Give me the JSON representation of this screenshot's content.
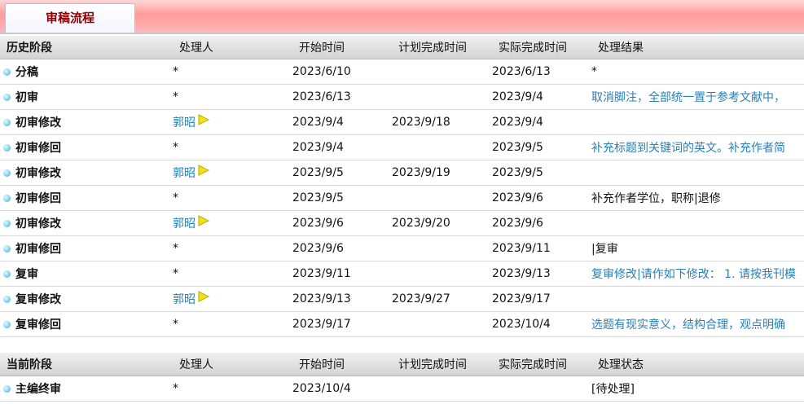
{
  "tab": {
    "label": "审稿流程"
  },
  "history": {
    "headers": [
      "历史阶段",
      "处理人",
      "开始时间",
      "计划完成时间",
      "实际完成时间",
      "处理结果"
    ],
    "rows": [
      {
        "stage": "分稿",
        "person": "*",
        "start": "2023/6/10",
        "plan": "",
        "actual": "2023/6/13",
        "result": "*",
        "person_link": false,
        "result_link": false
      },
      {
        "stage": "初审",
        "person": "*",
        "start": "2023/6/13",
        "plan": "",
        "actual": "2023/9/4",
        "result": "取消脚注，全部统一置于参考文献中，",
        "person_link": false,
        "result_link": true
      },
      {
        "stage": "初审修改",
        "person": "郭昭",
        "start": "2023/9/4",
        "plan": "2023/9/18",
        "actual": "2023/9/4",
        "result": "",
        "person_link": true,
        "result_link": false
      },
      {
        "stage": "初审修回",
        "person": "*",
        "start": "2023/9/4",
        "plan": "",
        "actual": "2023/9/5",
        "result": "补充标题到关键词的英文。补充作者简",
        "person_link": false,
        "result_link": true
      },
      {
        "stage": "初审修改",
        "person": "郭昭",
        "start": "2023/9/5",
        "plan": "2023/9/19",
        "actual": "2023/9/5",
        "result": "",
        "person_link": true,
        "result_link": false
      },
      {
        "stage": "初审修回",
        "person": "*",
        "start": "2023/9/5",
        "plan": "",
        "actual": "2023/9/6",
        "result": "补充作者学位，职称|退修",
        "person_link": false,
        "result_link": false
      },
      {
        "stage": "初审修改",
        "person": "郭昭",
        "start": "2023/9/6",
        "plan": "2023/9/20",
        "actual": "2023/9/6",
        "result": "",
        "person_link": true,
        "result_link": false
      },
      {
        "stage": "初审修回",
        "person": "*",
        "start": "2023/9/6",
        "plan": "",
        "actual": "2023/9/11",
        "result": "|复审",
        "person_link": false,
        "result_link": false
      },
      {
        "stage": "复审",
        "person": "*",
        "start": "2023/9/11",
        "plan": "",
        "actual": "2023/9/13",
        "result": "复审修改|请作如下修改： 1. 请按我刊模",
        "person_link": false,
        "result_link": true
      },
      {
        "stage": "复审修改",
        "person": "郭昭",
        "start": "2023/9/13",
        "plan": "2023/9/27",
        "actual": "2023/9/17",
        "result": "",
        "person_link": true,
        "result_link": false
      },
      {
        "stage": "复审修回",
        "person": "*",
        "start": "2023/9/17",
        "plan": "",
        "actual": "2023/10/4",
        "result": "选题有现实意义，结构合理，观点明确",
        "person_link": false,
        "result_link": true
      }
    ]
  },
  "current": {
    "headers": [
      "当前阶段",
      "处理人",
      "开始时间",
      "计划完成时间",
      "实际完成时间",
      "处理状态"
    ],
    "rows": [
      {
        "stage": "主编终审",
        "person": "*",
        "start": "2023/10/4",
        "plan": "",
        "actual": "",
        "result": "[待处理]",
        "person_link": false,
        "result_link": false
      }
    ]
  },
  "colors": {
    "link": "#2a7fb5",
    "tab_text": "#8b0000"
  },
  "icons": {
    "row_bullet": "dot-icon",
    "person_action": "flag-icon"
  }
}
